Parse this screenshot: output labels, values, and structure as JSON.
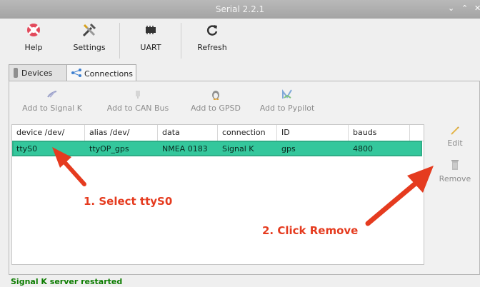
{
  "window": {
    "title": "Serial 2.2.1",
    "controls": [
      "⌄",
      "⌃",
      "✕"
    ]
  },
  "toolbar": {
    "items": [
      {
        "label": "Help",
        "icon": "lifebuoy-icon"
      },
      {
        "label": "Settings",
        "icon": "tools-icon"
      },
      {
        "label": "UART",
        "icon": "chip-icon"
      },
      {
        "label": "Refresh",
        "icon": "refresh-icon"
      }
    ]
  },
  "tabs": [
    {
      "label": "Devices",
      "active": false
    },
    {
      "label": "Connections",
      "active": true
    }
  ],
  "actions": [
    {
      "label": "Add to Signal K"
    },
    {
      "label": "Add to CAN Bus"
    },
    {
      "label": "Add to GPSD"
    },
    {
      "label": "Add to Pypilot"
    }
  ],
  "table": {
    "headers": [
      "device /dev/",
      "alias /dev/",
      "data",
      "connection",
      "ID",
      "bauds"
    ],
    "rows": [
      [
        "ttyS0",
        "ttyOP_gps",
        "NMEA 0183",
        "Signal K",
        "gps",
        "4800"
      ]
    ]
  },
  "side_actions": {
    "edit": "Edit",
    "remove": "Remove"
  },
  "annotations": {
    "step1": "1. Select ttyS0",
    "step2": "2. Click Remove"
  },
  "status": "Signal K server restarted",
  "colors": {
    "accent_row": "#34c79c",
    "annotation": "#e53b1f",
    "status": "#0c7c00"
  }
}
